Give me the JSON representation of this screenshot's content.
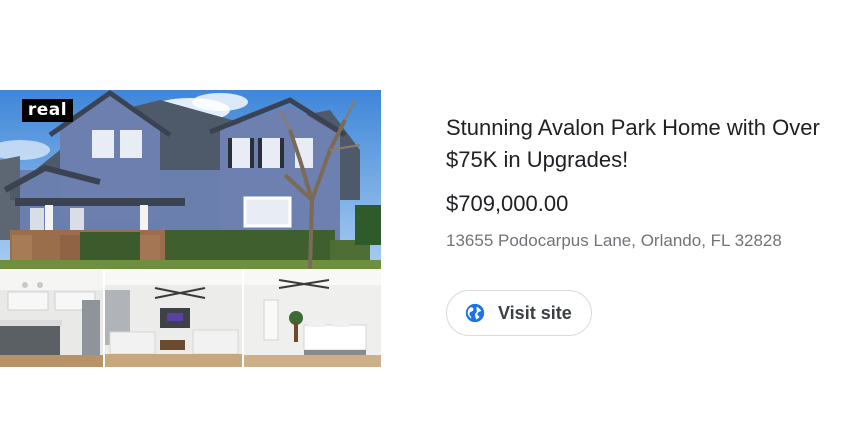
{
  "listing": {
    "brand_logo_text": "real",
    "title": "Stunning Avalon Park Home with Over $75K in Upgrades!",
    "price": "$709,000.00",
    "address": "13655 Podocarpus Lane, Orlando, FL 32828",
    "visit_label": "Visit site"
  },
  "icons": {
    "visit": "globe-icon"
  },
  "colors": {
    "accent_blue": "#1a73e8",
    "title_text": "#202124",
    "secondary_text": "#70757a",
    "button_border": "#dadce0"
  }
}
